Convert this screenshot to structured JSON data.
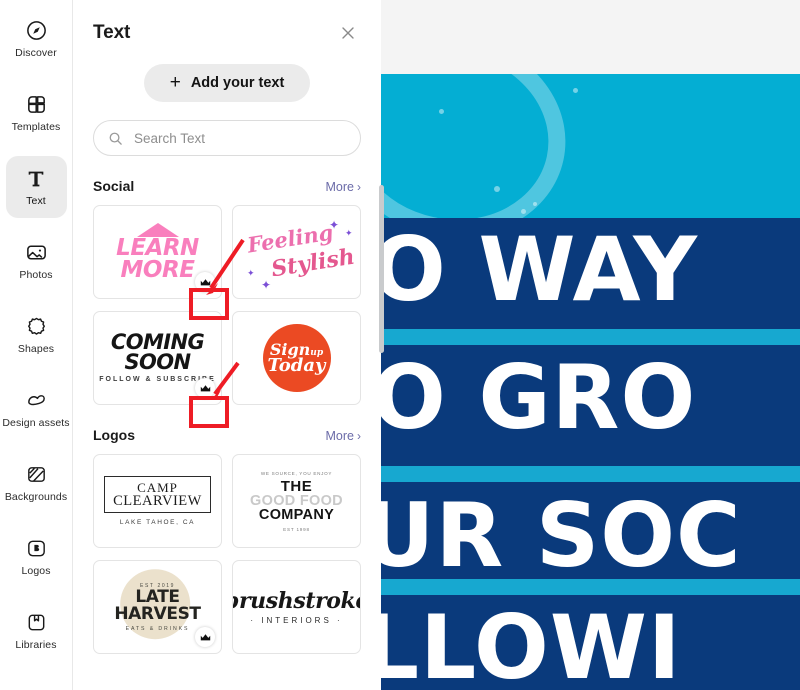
{
  "sidebar": {
    "items": [
      {
        "label": "Discover",
        "icon": "compass-icon",
        "active": false
      },
      {
        "label": "Templates",
        "icon": "templates-icon",
        "active": false
      },
      {
        "label": "Text",
        "icon": "text-t-icon",
        "active": true
      },
      {
        "label": "Photos",
        "icon": "photo-icon",
        "active": false
      },
      {
        "label": "Shapes",
        "icon": "shapes-icon",
        "active": false
      },
      {
        "label": "Design assets",
        "icon": "design-assets-icon",
        "active": false
      },
      {
        "label": "Backgrounds",
        "icon": "backgrounds-icon",
        "active": false
      },
      {
        "label": "Logos",
        "icon": "logos-b-icon",
        "active": false
      },
      {
        "label": "Libraries",
        "icon": "libraries-icon",
        "active": false
      }
    ]
  },
  "panel": {
    "title": "Text",
    "close_icon": "close-icon",
    "add_text_button": "Add your text",
    "add_text_plus": "+",
    "search": {
      "icon": "search-icon",
      "placeholder": "Search Text",
      "value": ""
    },
    "sections": [
      {
        "title": "Social",
        "more_label": "More",
        "more_chevron": "›",
        "cards": [
          {
            "name": "learn-more-card",
            "lines": [
              "LEARN",
              "MORE"
            ],
            "premium": true,
            "premium_icon": "crown-icon",
            "annotated": true
          },
          {
            "name": "feeling-stylish-card",
            "lines": [
              "Feeling",
              "Stylish"
            ],
            "premium": false,
            "annotated": false
          },
          {
            "name": "coming-soon-card",
            "lines": [
              "COMING",
              "SOON"
            ],
            "subtitle": "FOLLOW & SUBSCRIBE",
            "premium": true,
            "premium_icon": "crown-icon",
            "annotated": true
          },
          {
            "name": "sign-up-today-card",
            "lines": [
              "Sign",
              "up",
              "Today"
            ],
            "premium": false,
            "annotated": false
          }
        ]
      },
      {
        "title": "Logos",
        "more_label": "More",
        "more_chevron": "›",
        "cards": [
          {
            "name": "camp-clearview-card",
            "lines": [
              "CAMP",
              "CLEARVIEW"
            ],
            "subtitle": "LAKE TAHOE, CA",
            "premium": false,
            "annotated": false
          },
          {
            "name": "good-food-company-card",
            "top_line": "WE SOURCE, YOU ENJOY",
            "lines": [
              "THE",
              "GOOD FOOD",
              "COMPANY"
            ],
            "subtitle": "EST 1998",
            "premium": false,
            "annotated": false
          },
          {
            "name": "late-harvest-card",
            "top_line": "EST 2019",
            "lines": [
              "LATE HARVEST"
            ],
            "subtitle": "EATS & DRINKS",
            "premium": true,
            "premium_icon": "crown-icon",
            "annotated": false
          },
          {
            "name": "brushstroke-interiors-card",
            "lines": [
              "brushstroke"
            ],
            "subtitle": "· INTERIORS ·",
            "premium": false,
            "annotated": false
          }
        ]
      }
    ],
    "scrollbar": {
      "name": "panel-scrollbar"
    }
  },
  "canvas": {
    "text_lines": [
      "O WAY",
      "O GRO",
      "UR SOC",
      "LLOWI"
    ],
    "colors": {
      "cyan": "#04aed3",
      "cyan_stripe": "#17a8d0",
      "navy": "#0a3a7c",
      "white": "#ffffff",
      "canvas_bg": "#f4f4f4"
    }
  },
  "annotations": {
    "color": "#ee1c25",
    "arrows": [
      {
        "name": "annotation-arrow-learn-more"
      },
      {
        "name": "annotation-arrow-coming-soon"
      }
    ],
    "boxes": [
      {
        "name": "annotation-box-learn-more-crown"
      },
      {
        "name": "annotation-box-coming-soon-crown"
      }
    ]
  }
}
